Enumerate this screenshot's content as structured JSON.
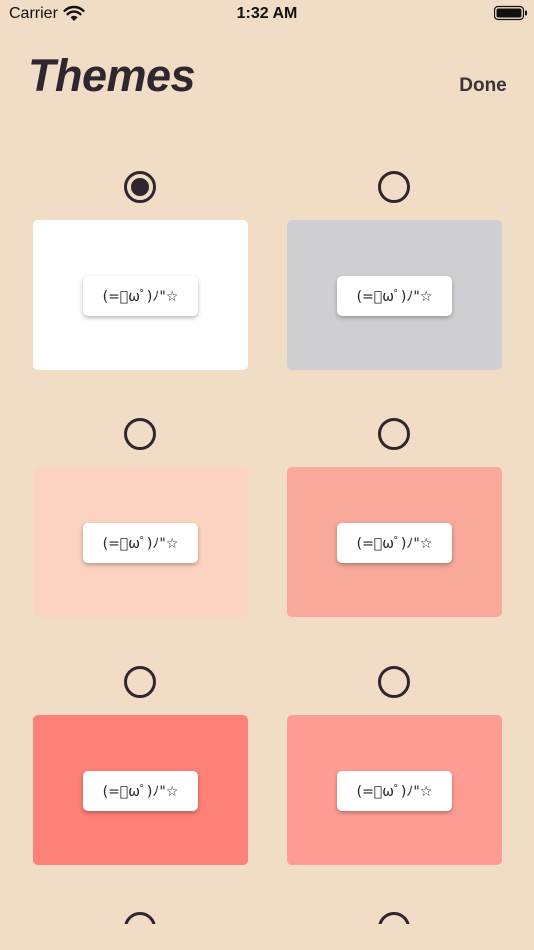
{
  "status_bar": {
    "carrier": "Carrier",
    "time": "1:32 AM"
  },
  "header": {
    "title": "Themes",
    "done_label": "Done"
  },
  "themes": [
    {
      "color": "#ffffff",
      "selected": true,
      "sample": "(=ﾟωﾟ)ﾉ\"☆"
    },
    {
      "color": "#cfcfd3",
      "selected": false,
      "sample": "(=ﾟωﾟ)ﾉ\"☆"
    },
    {
      "color": "#fcd2c0",
      "selected": false,
      "sample": "(=ﾟωﾟ)ﾉ\"☆"
    },
    {
      "color": "#f8a999",
      "selected": false,
      "sample": "(=ﾟωﾟ)ﾉ\"☆"
    },
    {
      "color": "#fe8177",
      "selected": false,
      "sample": "(=ﾟωﾟ)ﾉ\"☆"
    },
    {
      "color": "#fe9c93",
      "selected": false,
      "sample": "(=ﾟωﾟ)ﾉ\"☆"
    }
  ],
  "colors": {
    "background": "#f1dcc6",
    "ink": "#2f2630"
  }
}
